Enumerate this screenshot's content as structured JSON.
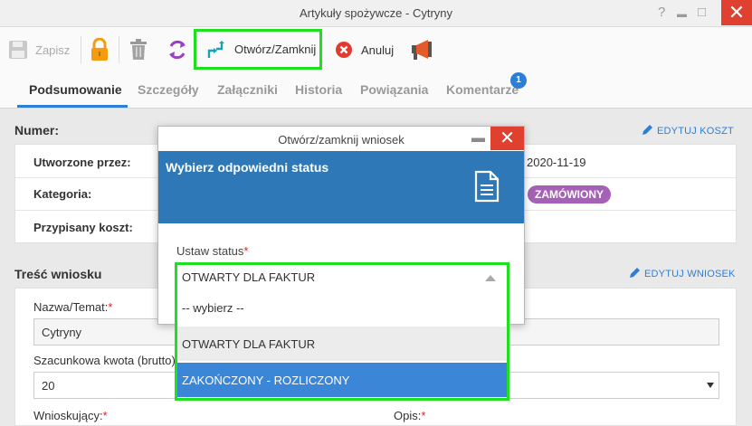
{
  "window": {
    "title": "Artykuły spożywcze - Cytryny",
    "help": "?",
    "minimize": "▬",
    "maximize": "□",
    "close": "✕"
  },
  "toolbar": {
    "save_label": "Zapisz",
    "open_close_label": "Otwórz/Zamknij",
    "cancel_label": "Anuluj",
    "icons": [
      "save-icon",
      "lock-icon",
      "trash-icon",
      "refresh-icon",
      "open-close-icon",
      "cancel-icon",
      "megaphone-icon"
    ]
  },
  "tabs": [
    {
      "label": "Podsumowanie",
      "active": true
    },
    {
      "label": "Szczegóły",
      "active": false
    },
    {
      "label": "Załączniki",
      "active": false
    },
    {
      "label": "Historia",
      "active": false
    },
    {
      "label": "Powiązania",
      "active": false
    },
    {
      "label": "Komentarze",
      "active": false
    }
  ],
  "comments_badge": "1",
  "summary": {
    "heading": "Numer:",
    "edit_cost_label": "EDYTUJ KOSZT",
    "rows": [
      {
        "label": "Utworzone przez:",
        "value": "2020-11-19"
      },
      {
        "label": "Kategoria:",
        "value": "ZAMÓWIONY"
      },
      {
        "label": "Przypisany koszt:",
        "value": ""
      }
    ]
  },
  "request": {
    "heading": "Treść wniosku",
    "edit_request_label": "EDYTUJ WNIOSEK",
    "name_label": "Nazwa/Temat:",
    "name_value": "Cytryny",
    "amount_label": "Szacunkowa kwota (brutto)",
    "amount_value": "20",
    "applicant_label": "Wnioskujący:",
    "description_label": "Opis:",
    "required_mark": "*"
  },
  "modal": {
    "title": "Otwórz/zamknij wniosek",
    "heading": "Wybierz odpowiedni status",
    "status_label": "Ustaw status",
    "required_mark": "*",
    "selected_value": "OTWARTY DLA FAKTUR",
    "options": [
      {
        "label": "-- wybierz --",
        "state": "normal"
      },
      {
        "label": "OTWARTY DLA FAKTUR",
        "state": "hover"
      },
      {
        "label": "ZAKOŃCZONY - ROZLICZONY",
        "state": "selected"
      }
    ]
  },
  "colors": {
    "accent": "#2d7fd6",
    "close_red": "#e0402f",
    "highlight_green": "#1fe01f",
    "status_purple": "#a461b5",
    "modal_blue": "#2e78b7"
  }
}
